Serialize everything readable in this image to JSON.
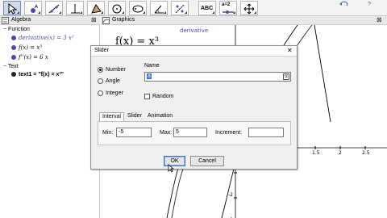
{
  "toolbar": {
    "tools": [
      "move-tool",
      "point-tool",
      "line-tool",
      "perpendicular-tool",
      "polygon-tool",
      "circle-tool",
      "conic-tool",
      "angle-tool",
      "reflect-tool",
      "text-tool",
      "slider-tool",
      "move-view-tool"
    ],
    "text_tool_label": "ABC",
    "slider_tool_label": "a=2",
    "help_label": "?"
  },
  "algebra": {
    "title": "Algebra",
    "categories": {
      "function": "Function",
      "text": "Text"
    },
    "functions": [
      {
        "name": "derivative(x) = 3 x²",
        "color": "#4a4ab5"
      },
      {
        "name": "f(x) = x³",
        "color": "#4a4ab5"
      },
      {
        "name": "f''(x) = 6 x",
        "color": "#4a4ab5"
      }
    ],
    "text_item": "text1 = \"f(x) = x³\""
  },
  "graphics": {
    "title": "Graphics",
    "formula": "f(x) = x³",
    "curve_label": "derivative",
    "x_ticks": [
      "1.5",
      "2",
      "2.5"
    ],
    "y_ticks": [
      "-2",
      "-3"
    ]
  },
  "dialog": {
    "title": "Slider",
    "close": "✕",
    "radios": [
      {
        "label": "Number",
        "selected": true
      },
      {
        "label": "Angle",
        "selected": false
      },
      {
        "label": "Integer",
        "selected": false
      }
    ],
    "name_label": "Name",
    "name_value": "a",
    "random_label": "Random",
    "tabs": [
      "Interval",
      "Slider",
      "Animation"
    ],
    "min_label": "Min:",
    "min_value": "-5",
    "max_label": "Max:",
    "max_value": "5",
    "increment_label": "Increment:",
    "increment_value": "",
    "ok_label": "OK",
    "cancel_label": "Cancel"
  }
}
